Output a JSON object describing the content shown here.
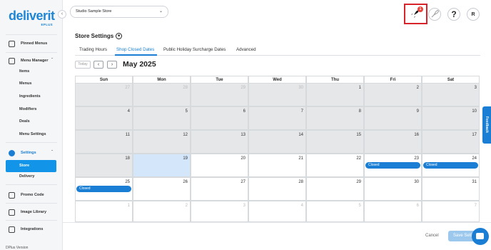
{
  "sidebar": {
    "logo_text": "deliverit",
    "logo_sub": "EPLUS",
    "collapse_icon": "‹",
    "pinned_label": "Pinned Menus",
    "menu_manager_label": "Menu Manager",
    "menu_manager_subitems": [
      "Items",
      "Menus",
      "Ingredients",
      "Modifiers",
      "Deals",
      "Menu Settings"
    ],
    "settings_label": "Settings",
    "store_label": "Store",
    "delivery_label": "Delivery",
    "promo_label": "Promo Code",
    "image_library_label": "Image Library",
    "integrations_label": "Integrations",
    "version_label": "DPlus Version"
  },
  "header": {
    "store_select": "Studio Sample Store",
    "notification_count": "1",
    "help_label": "?",
    "avatar_initial": "R"
  },
  "page": {
    "title": "Store Settings",
    "tabs": [
      "Trading Hours",
      "Shop Closed Dates",
      "Public Holiday Surcharge Dates",
      "Advanced"
    ],
    "active_tab": "Shop Closed Dates"
  },
  "calendar": {
    "today_label": "Today",
    "prev_icon": "‹",
    "next_icon": "›",
    "month_label": "May 2025",
    "weekdays": [
      "Sun",
      "Mon",
      "Tue",
      "Wed",
      "Thu",
      "Fri",
      "Sat"
    ],
    "weeks": [
      [
        "27",
        "28",
        "29",
        "30",
        "1",
        "2",
        "3"
      ],
      [
        "4",
        "5",
        "6",
        "7",
        "8",
        "9",
        "10"
      ],
      [
        "11",
        "12",
        "13",
        "14",
        "15",
        "16",
        "17"
      ],
      [
        "18",
        "19",
        "20",
        "21",
        "22",
        "23",
        "24"
      ],
      [
        "25",
        "26",
        "27",
        "28",
        "29",
        "30",
        "31"
      ],
      [
        "1",
        "2",
        "3",
        "4",
        "5",
        "6",
        "7"
      ]
    ],
    "event_label": "Closed"
  },
  "footer": {
    "cancel_label": "Cancel",
    "save_label": "Save Sett"
  },
  "feedback_label": "Feedback",
  "colors": {
    "accent": "#1a7fd4",
    "highlight": "#d8232a",
    "past_day": "#e6e7e9",
    "today": "#d4e6fa"
  }
}
